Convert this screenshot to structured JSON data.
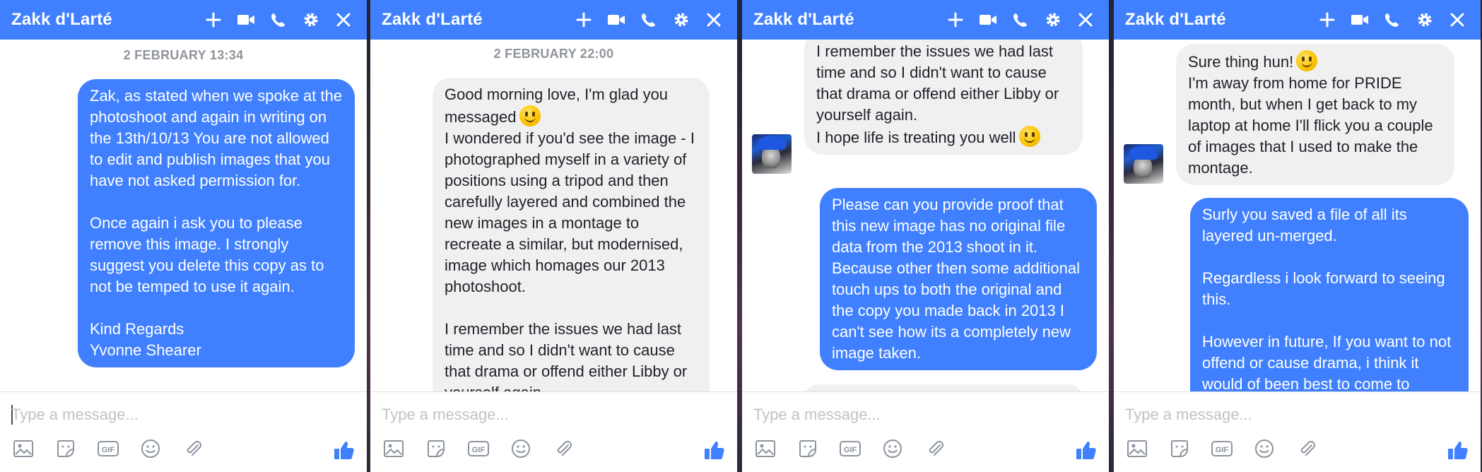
{
  "panels": [
    {
      "contact_name": "Zakk d'Larté",
      "date_label": "2 FEBRUARY 13:34",
      "bubble1": {
        "text": "Zak, as stated when we spoke at the photoshoot and again in writing on the 13th/10/13 You are not allowed to edit and publish images that you have not asked permission for.\n\nOnce again i ask you to please remove this image. I strongly suggest you delete this copy as to not be temped to use it again.\n\nKind Regards\nYvonne Shearer"
      },
      "composer_placeholder": "Type a message..."
    },
    {
      "contact_name": "Zakk d'Larté",
      "date_label": "2 FEBRUARY 22:00",
      "bubble1": {
        "text_a": "Good morning love, I'm glad you messaged",
        "text_b": "\nI wondered if you'd see the image - I photographed myself in a variety of positions using a tripod and then carefully layered and combined the new images in a montage to recreate a similar, but modernised, image which homages our 2013 photoshoot.\n\nI remember the issues we had last time and so I didn't want to cause that drama or offend either Libby or yourself again."
      },
      "composer_placeholder": "Type a message..."
    },
    {
      "contact_name": "Zakk d'Larté",
      "bubble1": {
        "text_a": "I remember the issues we had last time and so I didn't want to cause that drama or offend either Libby or yourself again.\nI hope life is treating you well"
      },
      "bubble2": {
        "text": "Please can you provide proof that this new image has no original file data from the 2013 shoot in it. Because other then some additional touch ups to both the original and the copy you made back in 2013 I can't see how its a completely new image taken."
      },
      "composer_placeholder": "Type a message..."
    },
    {
      "contact_name": "Zakk d'Larté",
      "bubble1": {
        "text_a": "Sure thing hun!",
        "text_b": "\nI'm away from home for PRIDE month, but when I get back to my laptop at home I'll flick you a couple of images that I used to make the montage."
      },
      "bubble2": {
        "text": "Surly you saved a file of all its layered un-merged.\n\nRegardless i look forward to seeing this.\n\nHowever in future, If you want to not offend or cause drama, i think it would of been best to come to"
      },
      "composer_placeholder": "Type a message..."
    }
  ],
  "icons": {
    "header": [
      "plus-icon",
      "video-camera-icon",
      "phone-icon",
      "gear-icon",
      "close-icon"
    ],
    "toolbar": [
      "image-icon",
      "sticker-icon",
      "gif-icon",
      "emoji-icon",
      "attachment-icon",
      "thumbs-up-icon"
    ]
  },
  "colors": {
    "accent": "#4080ff",
    "incoming_bubble": "#f1f0f0",
    "date_text": "#90949c"
  }
}
